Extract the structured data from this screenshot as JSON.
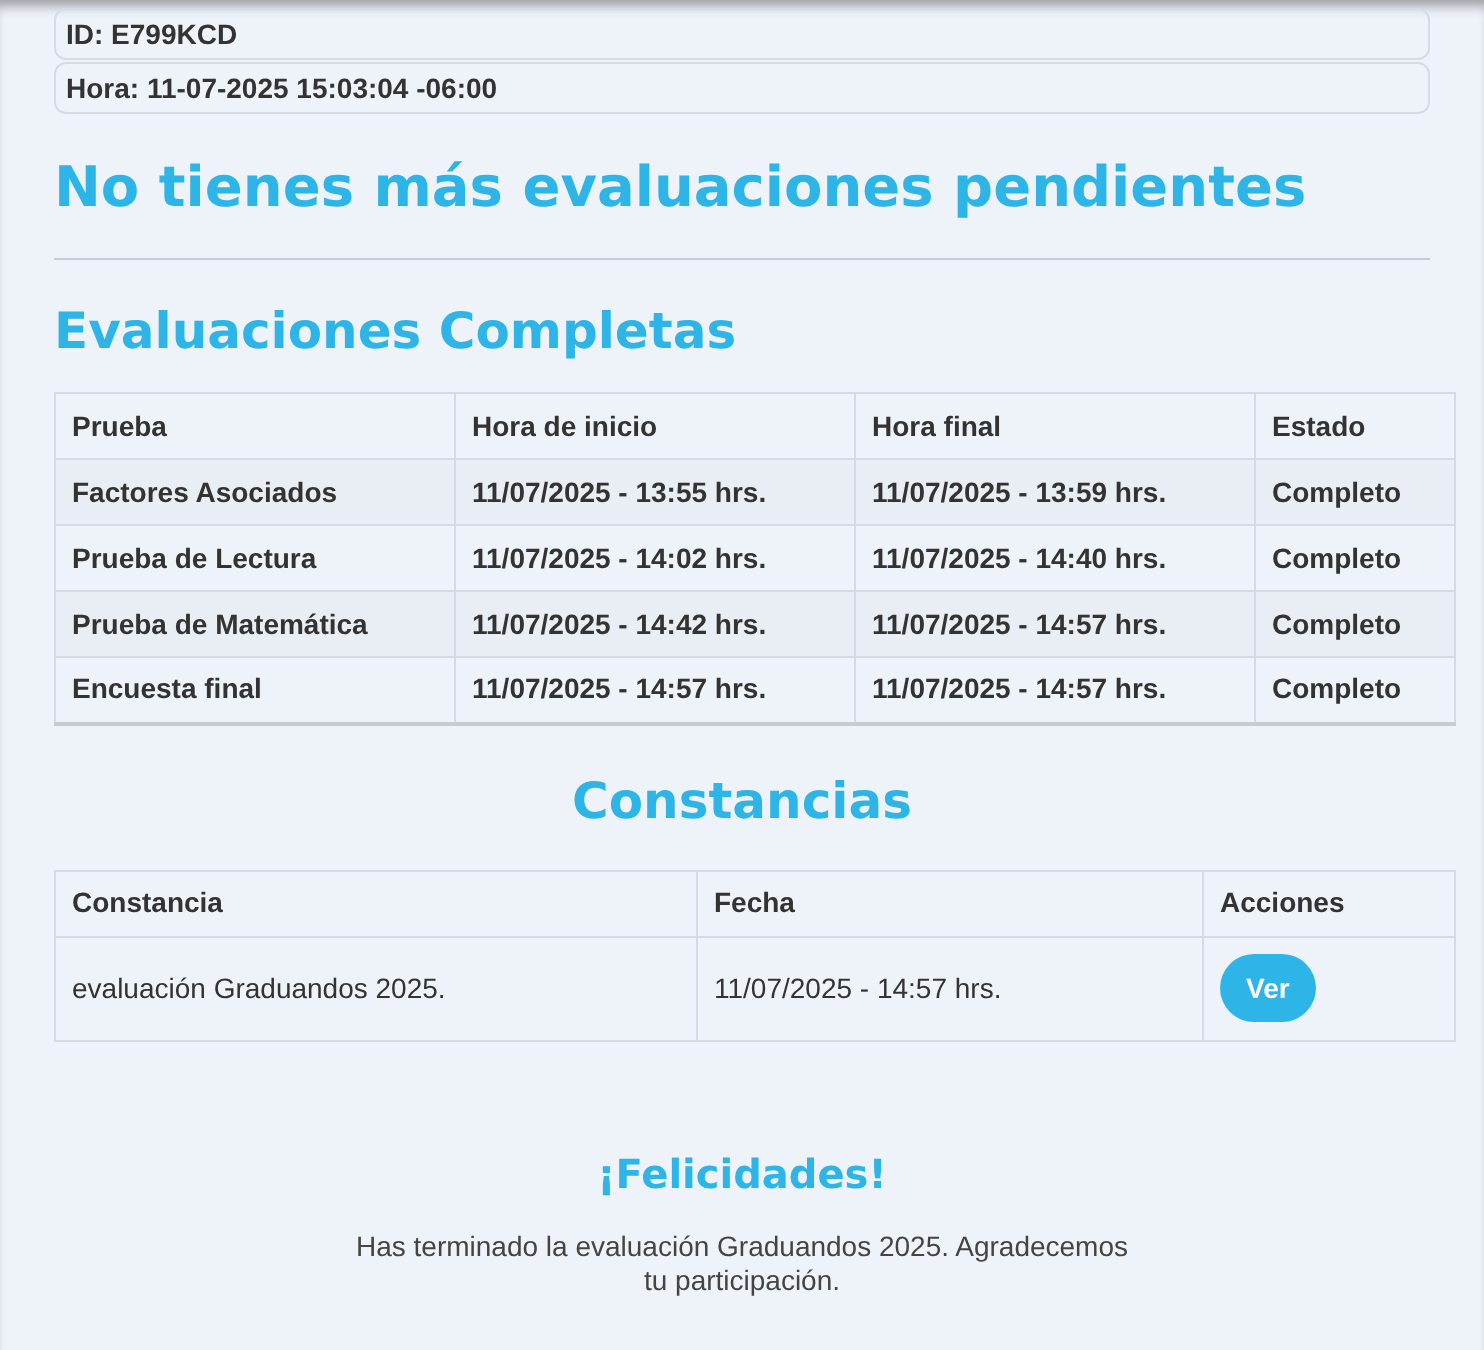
{
  "info": [
    "ID: E799KCD",
    "Hora: 11-07-2025 15:03:04 -06:00"
  ],
  "pending_title": "No tienes más evaluaciones pendientes",
  "completed": {
    "title": "Evaluaciones Completas",
    "columns": [
      "Prueba",
      "Hora de inicio",
      "Hora final",
      "Estado"
    ],
    "rows": [
      [
        "Factores Asociados",
        "11/07/2025 - 13:55 hrs.",
        "11/07/2025 - 13:59 hrs.",
        "Completo"
      ],
      [
        "Prueba de Lectura",
        "11/07/2025 - 14:02 hrs.",
        "11/07/2025 - 14:40 hrs.",
        "Completo"
      ],
      [
        "Prueba de Matemática",
        "11/07/2025 - 14:42 hrs.",
        "11/07/2025 - 14:57 hrs.",
        "Completo"
      ],
      [
        "Encuesta final",
        "11/07/2025 - 14:57 hrs.",
        "11/07/2025 - 14:57 hrs.",
        "Completo"
      ]
    ]
  },
  "certificates": {
    "title": "Constancias",
    "columns": [
      "Constancia",
      "Fecha",
      "Acciones"
    ],
    "rows": [
      {
        "name": "evaluación Graduandos 2025.",
        "date": "11/07/2025 - 14:57 hrs.",
        "action": "Ver"
      }
    ]
  },
  "congrats": {
    "title": "¡Felicidades!",
    "message": "Has terminado la evaluación Graduandos 2025. Agradecemos tu participación."
  }
}
